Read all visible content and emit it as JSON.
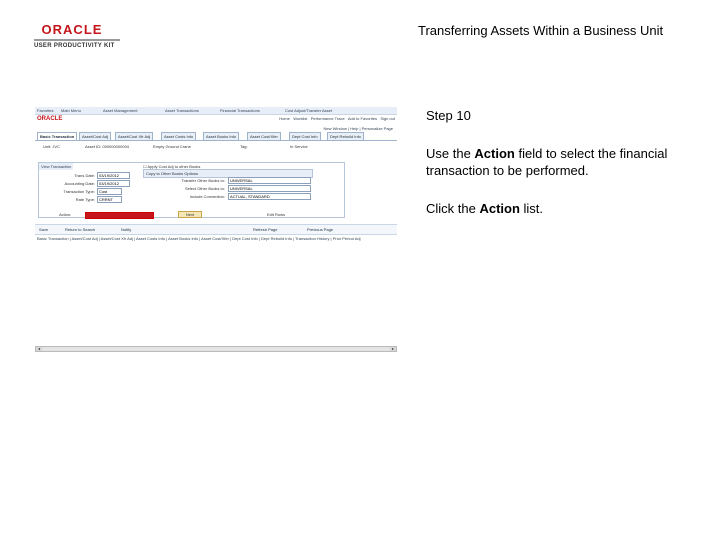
{
  "header": {
    "logo_brand": "ORACLE",
    "logo_product": "USER PRODUCTIVITY KIT",
    "slide_title": "Transferring Assets Within a Business Unit"
  },
  "instructions": {
    "step": "Step 10",
    "line1_pre": "Use the ",
    "line1_bold": "Action",
    "line1_post": " field to select the financial transaction to be performed.",
    "line2_pre": "Click the ",
    "line2_bold": "Action",
    "line2_post": " list."
  },
  "screenshot": {
    "nav_items": [
      "Favorites",
      "Main Menu",
      "Asset Management",
      "Asset Transactions",
      "Financial Transactions",
      "Cost Adjust/Transfer Asset"
    ],
    "brand": "ORACLE",
    "top_links": [
      "Home",
      "Worklist",
      "Performance Trace",
      "Add to Favorites",
      "Sign out"
    ],
    "util_links": "New Window | Help | Personalize Page",
    "tabs": [
      "Basic Transaction",
      "Asset/Cost Adj",
      "Asset/Cost Xfr Adj",
      "Asset Costs Info",
      "Asset Books Info",
      "Asset Cost/Xfer",
      "Dept Cost Info",
      "Dept Rebuild Info"
    ],
    "header_fields": [
      "Unit: JVC",
      "Asset ID: 000000000004",
      "Empty Ground Crane",
      "Tag:",
      "In Service"
    ],
    "view_caption": "View Transaction",
    "fields": [
      {
        "label": "Trans Date:",
        "value": "03/19/2012"
      },
      {
        "label": "Accounting Date:",
        "value": "03/19/2012"
      },
      {
        "label": "Transaction Type:",
        "value": "Cost"
      },
      {
        "label": "Rate Type:",
        "value": "CRRNT"
      }
    ],
    "checkbox_label": "Apply Cost Adj to other Books",
    "options_link": "Copy to Other Books Options",
    "right_fields": [
      {
        "label": "Transfer Other Books to:",
        "value": "UNIVERSAL"
      },
      {
        "label": "Select Other Books to:",
        "value": "UNIVERSAL"
      },
      {
        "label": "Include Convention:",
        "value": "ACTUAL, STANDARD"
      }
    ],
    "action_label": "Action:",
    "next_button": "Next",
    "edit_label": "Edit Rows",
    "bottom_left": [
      "Save",
      "Return to Search",
      "Notify"
    ],
    "bottom_right": [
      "Refresh Page",
      "Previous Page"
    ],
    "bottom_links": "Basic Transaction | Asset/Cost Adj | Asset/Cost Xfr Adj | Asset Costs Info | Asset Books Info | Asset Cost/Xfer | Dept Cost Info | Dept Rebuild Info | Transaction History | Prior Period Adj"
  }
}
